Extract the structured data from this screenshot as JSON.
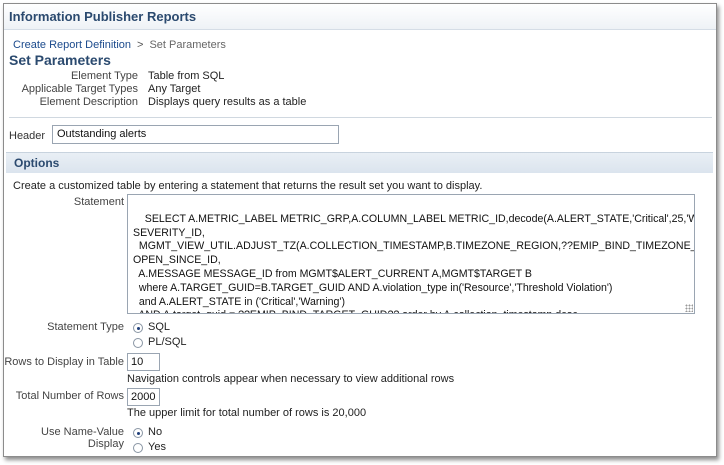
{
  "app": {
    "title": "Information Publisher Reports"
  },
  "breadcrumb": {
    "parent": "Create Report Definition",
    "separator": ">",
    "current": "Set Parameters"
  },
  "page": {
    "title": "Set Parameters"
  },
  "properties": [
    {
      "label": "Element Type",
      "value": "Table from SQL"
    },
    {
      "label": "Applicable Target Types",
      "value": "Any Target"
    },
    {
      "label": "Element Description",
      "value": "Displays query results as a table"
    }
  ],
  "header_field": {
    "label": "Header",
    "value": "Outstanding alerts"
  },
  "options": {
    "title": "Options",
    "instructions": "Create a customized table by entering a statement that returns the result set you want to display.",
    "statement": {
      "label": "Statement",
      "value": "SELECT A.METRIC_LABEL METRIC_GRP,A.COLUMN_LABEL METRIC_ID,decode(A.ALERT_STATE,'Critical',25,'Warning',20)\nSEVERITY_ID,\n  MGMT_VIEW_UTIL.ADJUST_TZ(A.COLLECTION_TIMESTAMP,B.TIMEZONE_REGION,??EMIP_BIND_TIMEZONE_REGION??)\nOPEN_SINCE_ID,\n  A.MESSAGE MESSAGE_ID from MGMT$ALERT_CURRENT A,MGMT$TARGET B\n  where A.TARGET_GUID=B.TARGET_GUID AND A.violation_type in('Resource','Threshold Violation')\n  and A.ALERT_STATE in ('Critical','Warning')\n  AND A.target_guid = ??EMIP_BIND_TARGET_GUID?? order by A.collection_timestamp desc"
    },
    "statement_type": {
      "label": "Statement Type",
      "options": [
        "SQL",
        "PL/SQL"
      ],
      "selected": "SQL"
    },
    "rows_to_display": {
      "label": "Rows to Display in Table",
      "value": "10",
      "hint": "Navigation controls appear when necessary to view additional rows"
    },
    "total_rows": {
      "label": "Total Number of Rows",
      "value": "2000",
      "hint": "The upper limit for total number of rows is 20,000"
    },
    "name_value_display": {
      "label": "Use Name-Value Display",
      "options": [
        "No",
        "Yes"
      ],
      "selected": "No"
    }
  }
}
